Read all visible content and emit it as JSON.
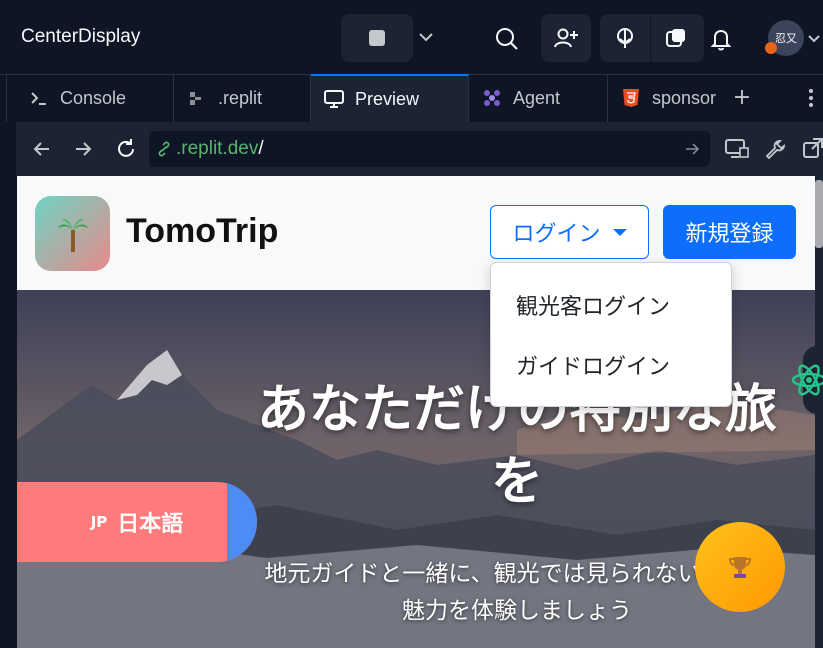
{
  "topbar": {
    "title": "CenterDisplay",
    "avatar_text": "忍又"
  },
  "tabs": [
    {
      "label": "Console",
      "icon": "terminal-icon"
    },
    {
      "label": ".replit",
      "icon": "config-icon"
    },
    {
      "label": "Preview",
      "icon": "monitor-icon",
      "active": true
    },
    {
      "label": "Agent",
      "icon": "agent-icon"
    },
    {
      "label": "sponsor",
      "icon": "html5-icon"
    }
  ],
  "address": {
    "url": ".replit.dev",
    "url_suffix": "/"
  },
  "site": {
    "brand": "TomoTrip",
    "login_label": "ログイン",
    "signup_label": "新規登録",
    "dropdown": [
      "観光客ログイン",
      "ガイドログイン"
    ],
    "hero_title": "あなただけの特別な旅を",
    "hero_subtitle": "地元ガイドと一緒に、観光では見られない隠れた魅力を体験しましょう",
    "lang_code": "JP",
    "lang_label": "日本語"
  },
  "colors": {
    "accent": "#0d6efd",
    "ide_bg": "#0e1525",
    "ide_panel": "#1c2333",
    "lang_button": "#ff7b7b",
    "trophy": "#ffb300"
  }
}
